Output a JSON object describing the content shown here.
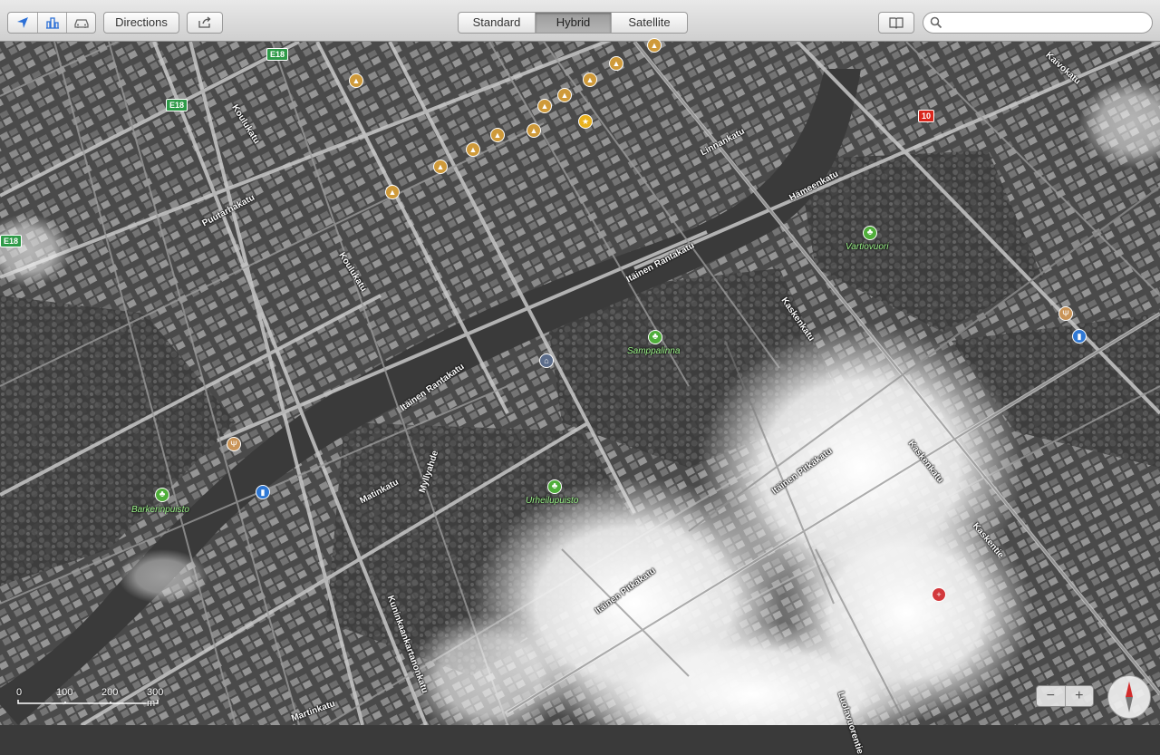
{
  "toolbar": {
    "directions_label": "Directions",
    "segments": [
      {
        "label": "Standard",
        "active": false
      },
      {
        "label": "Hybrid",
        "active": true
      },
      {
        "label": "Satellite",
        "active": false
      }
    ],
    "search_placeholder": "",
    "icons": [
      "location-arrow-icon",
      "3d-buildings-icon",
      "traffic-car-icon",
      "share-icon",
      "bookmarks-icon",
      "search-icon"
    ]
  },
  "map": {
    "road_labels": [
      "Koulukatu",
      "Puutarhakatu",
      "Koulukatu",
      "Linnankatu",
      "Hämeenkatu",
      "Kaivokatu",
      "Itäinen Rantakatu",
      "Itäinen Rantakatu",
      "Kaskenkatu",
      "Kaskenkatu",
      "Kaskentie",
      "Itäinen Pitkäkatu",
      "Itäinen Pitkäkatu",
      "Myllyahde",
      "Matinkatu",
      "Kuninkaankartanonkatu",
      "Luolavuorentie",
      "Martinkatu"
    ],
    "place_labels": [
      "Vartiovuori",
      "Samppalinna",
      "Urheilupuisto",
      "Barkerinpuisto"
    ],
    "shields": [
      "E18",
      "E18",
      "E18",
      "10"
    ],
    "scale": [
      "0",
      "100",
      "200",
      "300 m"
    ],
    "zoom": {
      "minus": "−",
      "plus": "+"
    }
  }
}
